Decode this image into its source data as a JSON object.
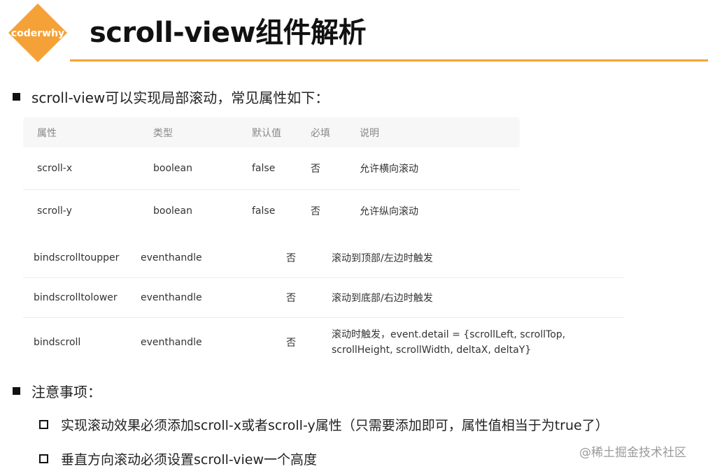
{
  "logo": {
    "text": "coderwhy",
    "color": "#f4a238"
  },
  "title": "scroll-view组件解析",
  "intro": "scroll-view可以实现局部滚动，常见属性如下：",
  "table": {
    "headers": [
      "属性",
      "类型",
      "默认值",
      "必填",
      "说明"
    ],
    "rows": [
      {
        "name": "scroll-x",
        "type": "boolean",
        "default": "false",
        "required": "否",
        "desc": "允许横向滚动"
      },
      {
        "name": "scroll-y",
        "type": "boolean",
        "default": "false",
        "required": "否",
        "desc": "允许纵向滚动"
      }
    ]
  },
  "table2": {
    "rows": [
      {
        "name": "bindscrolltoupper",
        "type": "eventhandle",
        "default": "",
        "required": "否",
        "desc": "滚动到顶部/左边时触发"
      },
      {
        "name": "bindscrolltolower",
        "type": "eventhandle",
        "default": "",
        "required": "否",
        "desc": "滚动到底部/右边时触发"
      },
      {
        "name": "bindscroll",
        "type": "eventhandle",
        "default": "",
        "required": "否",
        "desc": "滚动时触发，event.detail = {scrollLeft, scrollTop, scrollHeight, scrollWidth, deltaX, deltaY}"
      }
    ]
  },
  "notes": {
    "title": "注意事项：",
    "items": [
      "实现滚动效果必须添加scroll-x或者scroll-y属性（只需要添加即可，属性值相当于为true了）",
      "垂直方向滚动必须设置scroll-view一个高度"
    ]
  },
  "watermark": "@稀土掘金技术社区"
}
